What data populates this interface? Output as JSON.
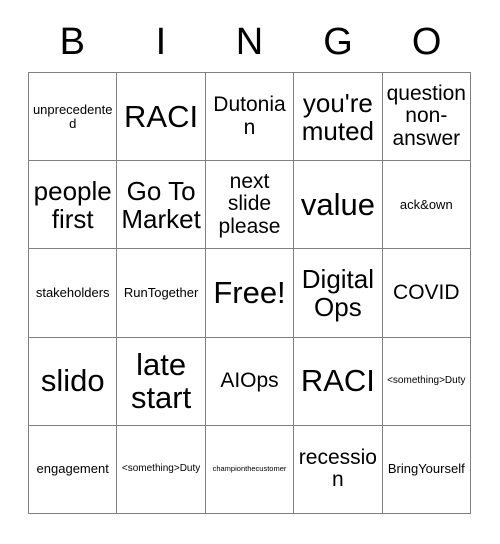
{
  "header": {
    "letters": [
      "B",
      "I",
      "N",
      "G",
      "O"
    ]
  },
  "grid": {
    "columns": 5,
    "rows": 5,
    "border_color": "#808080",
    "background_color": "#ffffff",
    "text_color": "#000000",
    "cells": [
      [
        {
          "text": "unprecedented",
          "size": "sm"
        },
        {
          "text": "RACI",
          "size": "xl"
        },
        {
          "text": "Dutonian",
          "size": "md"
        },
        {
          "text": "you're muted",
          "size": "lg"
        },
        {
          "text": "question non-answer",
          "size": "md"
        }
      ],
      [
        {
          "text": "people first",
          "size": "lg"
        },
        {
          "text": "Go To Market",
          "size": "lg"
        },
        {
          "text": "next slide please",
          "size": "md"
        },
        {
          "text": "value",
          "size": "xl"
        },
        {
          "text": "ack&own",
          "size": "sm"
        }
      ],
      [
        {
          "text": "stakeholders",
          "size": "sm"
        },
        {
          "text": "RunTogether",
          "size": "sm"
        },
        {
          "text": "Free!",
          "size": "xl"
        },
        {
          "text": "Digital Ops",
          "size": "lg"
        },
        {
          "text": "COVID",
          "size": "md"
        }
      ],
      [
        {
          "text": "slido",
          "size": "xl"
        },
        {
          "text": "late start",
          "size": "xl"
        },
        {
          "text": "AIOps",
          "size": "md"
        },
        {
          "text": "RACI",
          "size": "xl"
        },
        {
          "text": "<something>Duty",
          "size": "xs"
        }
      ],
      [
        {
          "text": "engagement",
          "size": "sm"
        },
        {
          "text": "<something>Duty",
          "size": "xs"
        },
        {
          "text": "championthecustomer",
          "size": "xxs"
        },
        {
          "text": "recession",
          "size": "md"
        },
        {
          "text": "BringYourself",
          "size": "sm"
        }
      ]
    ]
  }
}
